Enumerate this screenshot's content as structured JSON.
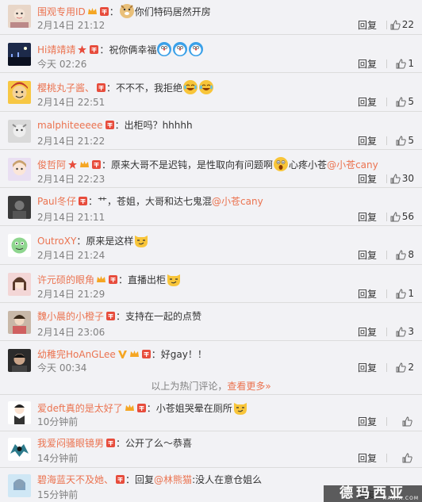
{
  "comments": [
    {
      "user": "围观专用ID",
      "sep": "：",
      "text": "你们特码居然开房",
      "mention": "",
      "date": "2月14日 21:12",
      "reply": "回复",
      "likes": "22"
    },
    {
      "user": "Hi靖靖靖",
      "sep": "：",
      "text": "祝你俩幸福",
      "mention": "",
      "date": "今天 02:26",
      "reply": "回复",
      "likes": "1"
    },
    {
      "user": "樱桃丸子酱、",
      "sep": "：",
      "text": "不不不，我拒绝",
      "mention": "",
      "date": "2月14日 22:51",
      "reply": "回复",
      "likes": "5"
    },
    {
      "user": "malphiteeeee",
      "sep": "：",
      "text": "出柜吗？hhhhh",
      "mention": "",
      "date": "2月14日 21:22",
      "reply": "回复",
      "likes": "5"
    },
    {
      "user": "俊哲阿",
      "sep": "：",
      "text": "原来大哥不是迟钝，是性取向有问题啊",
      "text2": "心疼小苍",
      "mention": "@小苍cany",
      "date": "2月14日 22:23",
      "reply": "回复",
      "likes": "30"
    },
    {
      "user": "Paul冬仔",
      "sep": "：",
      "text": "艹，苍姐，大哥和达七鬼混",
      "mention": "@小苍cany",
      "date": "2月14日 21:11",
      "reply": "回复",
      "likes": "56"
    },
    {
      "user": "OutroXY",
      "sep": "：",
      "text": "原来是这样",
      "mention": "",
      "date": "2月14日 21:24",
      "reply": "回复",
      "likes": "8"
    },
    {
      "user": "许元硕的眼角",
      "sep": "：",
      "text": "直播出柜",
      "mention": "",
      "date": "2月14日 21:29",
      "reply": "回复",
      "likes": "1"
    },
    {
      "user": "魏小晨的小橙子",
      "sep": "：",
      "text": "支持在一起的点赞",
      "mention": "",
      "date": "2月14日 23:06",
      "reply": "回复",
      "likes": "3"
    },
    {
      "user": "幼稚完HoAnGLee",
      "sep": "：",
      "text": "好gay！！",
      "mention": "",
      "date": "今天 00:34",
      "reply": "回复",
      "likes": "2"
    },
    {
      "user": "爱deft真的是太好了",
      "sep": "：",
      "text": "小苍姐哭晕在厕所",
      "mention": "",
      "date": "10分钟前",
      "reply": "回复",
      "likes": ""
    },
    {
      "user": "我爱闷骚眼镜男",
      "sep": "：",
      "text": "公开了么～恭喜",
      "mention": "",
      "date": "14分钟前",
      "reply": "回复",
      "likes": ""
    },
    {
      "user": "碧海蓝天不及她、",
      "sep": "：",
      "text": "回复",
      "mention": "@林熊猫",
      "text2": ":没人在意仓姐么",
      "date": "15分钟前",
      "reply": "回复",
      "likes": ""
    }
  ],
  "hot_divider": {
    "text": "以上为热门评论，",
    "link": "查看更多»"
  },
  "watermark": {
    "big": "德玛西亚",
    "small": "MAWIA.COM"
  },
  "colors": {
    "username": "#eb7350",
    "text": "#333333",
    "meta": "#808080",
    "background": "#f2f2f5"
  },
  "icons": [
    "thumb-up-icon",
    "vip-badge-icon",
    "crown-badge-icon",
    "star-badge-icon",
    "doge-emoji-icon",
    "laugh-cry-emoji-icon",
    "shocked-emoji-icon",
    "smirk-cat-emoji-icon"
  ]
}
